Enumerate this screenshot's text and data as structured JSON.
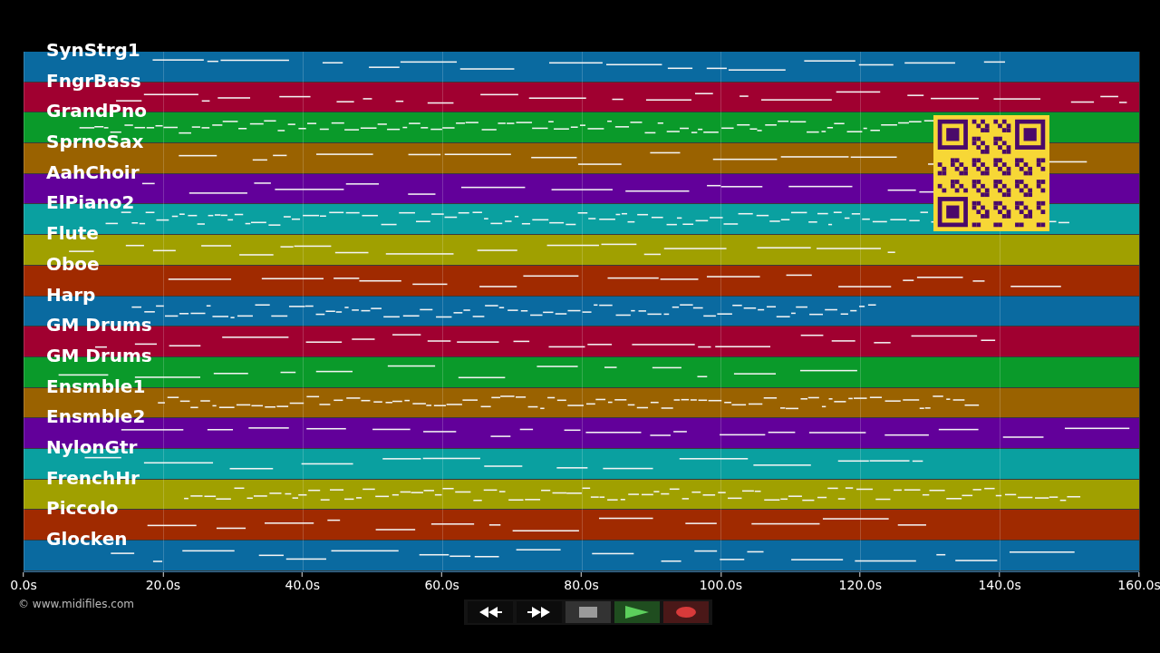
{
  "tracks": [
    {
      "name": "SynStrg1",
      "color": "#0a6aa0"
    },
    {
      "name": "FngrBass",
      "color": "#a00030"
    },
    {
      "name": "GrandPno",
      "color": "#0a9a2a"
    },
    {
      "name": "SprnoSax",
      "color": "#9a6200"
    },
    {
      "name": "AahChoir",
      "color": "#62009a"
    },
    {
      "name": "ElPiano2",
      "color": "#0aa0a0"
    },
    {
      "name": "Flute",
      "color": "#a0a000"
    },
    {
      "name": "Oboe",
      "color": "#a02a00"
    },
    {
      "name": "Harp",
      "color": "#0a6aa0"
    },
    {
      "name": "GM Drums",
      "color": "#a00030"
    },
    {
      "name": "GM Drums",
      "color": "#0a9a2a"
    },
    {
      "name": "Ensmble1",
      "color": "#9a6200"
    },
    {
      "name": "Ensmble2",
      "color": "#62009a"
    },
    {
      "name": "NylonGtr",
      "color": "#0aa0a0"
    },
    {
      "name": "FrenchHr",
      "color": "#a0a000"
    },
    {
      "name": "Piccolo",
      "color": "#a02a00"
    },
    {
      "name": "Glocken",
      "color": "#0a6aa0"
    }
  ],
  "time_axis": {
    "ticks": [
      "0.0s",
      "20.0s",
      "40.0s",
      "60.0s",
      "80.0s",
      "100.0s",
      "120.0s",
      "140.0s",
      "160.0s"
    ]
  },
  "credit": "© www.midifiles.com"
}
